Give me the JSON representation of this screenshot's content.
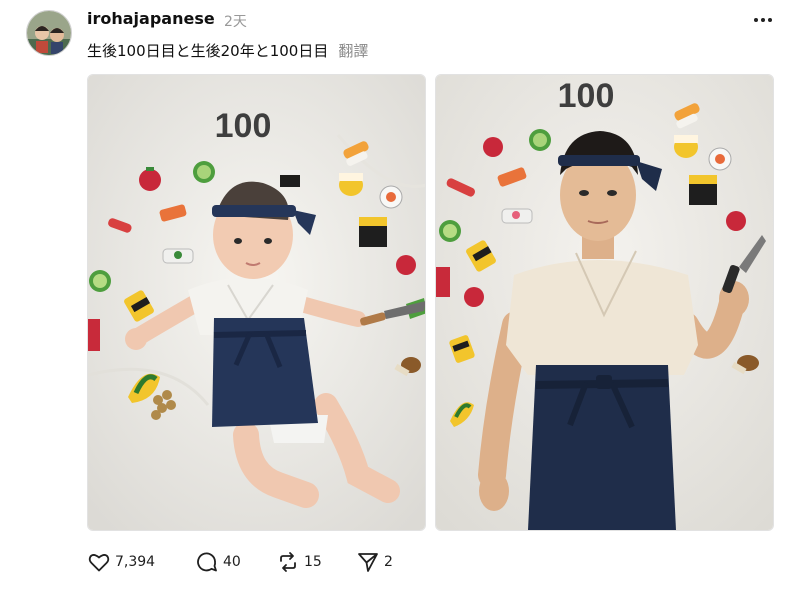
{
  "post": {
    "username": "irohajapanese",
    "time": "2天",
    "caption": "生後100日目と生後20年と100日目",
    "translate_label": "翻譯",
    "more_icon": "more-horizontal-icon"
  },
  "photos": [
    {
      "label": "100"
    },
    {
      "label": "100"
    }
  ],
  "actions": {
    "likes": "7,394",
    "comments": "40",
    "reposts": "15",
    "shares": "2"
  },
  "colors": {
    "text": "#101010",
    "muted": "#999999",
    "apron": "#1f2d4a",
    "sheet": "#f3f1ec"
  }
}
